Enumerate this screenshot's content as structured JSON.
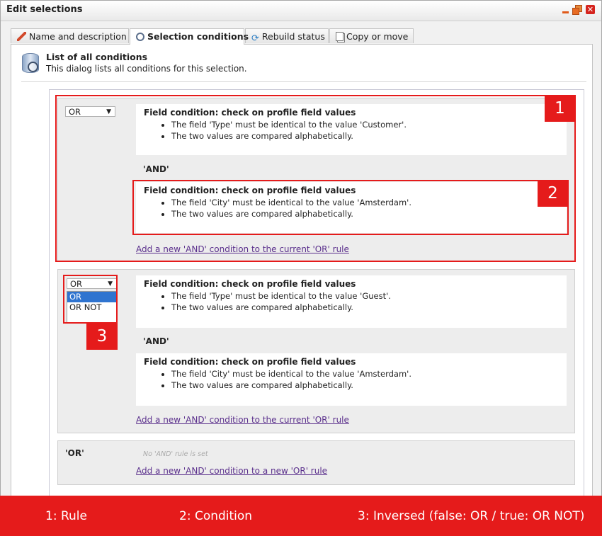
{
  "window": {
    "title": "Edit selections"
  },
  "tabs": [
    {
      "label": "Name and description",
      "icon": "pencil-icon"
    },
    {
      "label": "Selection conditions",
      "icon": "magnifier-icon"
    },
    {
      "label": "Rebuild status",
      "icon": "refresh-icon"
    },
    {
      "label": "Copy or move",
      "icon": "copy-icon"
    }
  ],
  "header": {
    "title": "List of all conditions",
    "subtitle": "This dialog lists all conditions for this selection."
  },
  "rules": [
    {
      "operator": "OR",
      "conditions": [
        {
          "title": "Field condition: check on profile field values",
          "bullets": [
            "The field 'Type' must be identical to the value 'Customer'.",
            "The two values are compared alphabetically."
          ]
        },
        {
          "title": "Field condition: check on profile field values",
          "bullets": [
            "The field 'City' must be identical to the value 'Amsterdam'.",
            "The two values are compared alphabetically."
          ]
        }
      ],
      "and_label": "'AND'",
      "add_link": "Add a new 'AND' condition to the current 'OR' rule"
    },
    {
      "operator": "OR",
      "dropdown_options": [
        "OR",
        "OR NOT"
      ],
      "dropdown_highlighted": "OR",
      "conditions": [
        {
          "title": "Field condition: check on profile field values",
          "bullets": [
            "The field 'Type' must be identical to the value 'Guest'.",
            "The two values are compared alphabetically."
          ]
        },
        {
          "title": "Field condition: check on profile field values",
          "bullets": [
            "The field 'City' must be identical to the value 'Amsterdam'.",
            "The two values are compared alphabetically."
          ]
        }
      ],
      "and_label": "'AND'",
      "add_link": "Add a new 'AND' condition to the current 'OR' rule"
    }
  ],
  "or_section": {
    "label": "'OR'",
    "empty_note": "No 'AND' rule is set",
    "add_link": "Add a new 'AND' condition to a new 'OR' rule"
  },
  "annotations": {
    "badges": [
      "1",
      "2",
      "3"
    ],
    "color": "#e51b1b",
    "legend": [
      "1: Rule",
      "2: Condition",
      "3: Inversed (false: OR / true: OR NOT)"
    ]
  }
}
